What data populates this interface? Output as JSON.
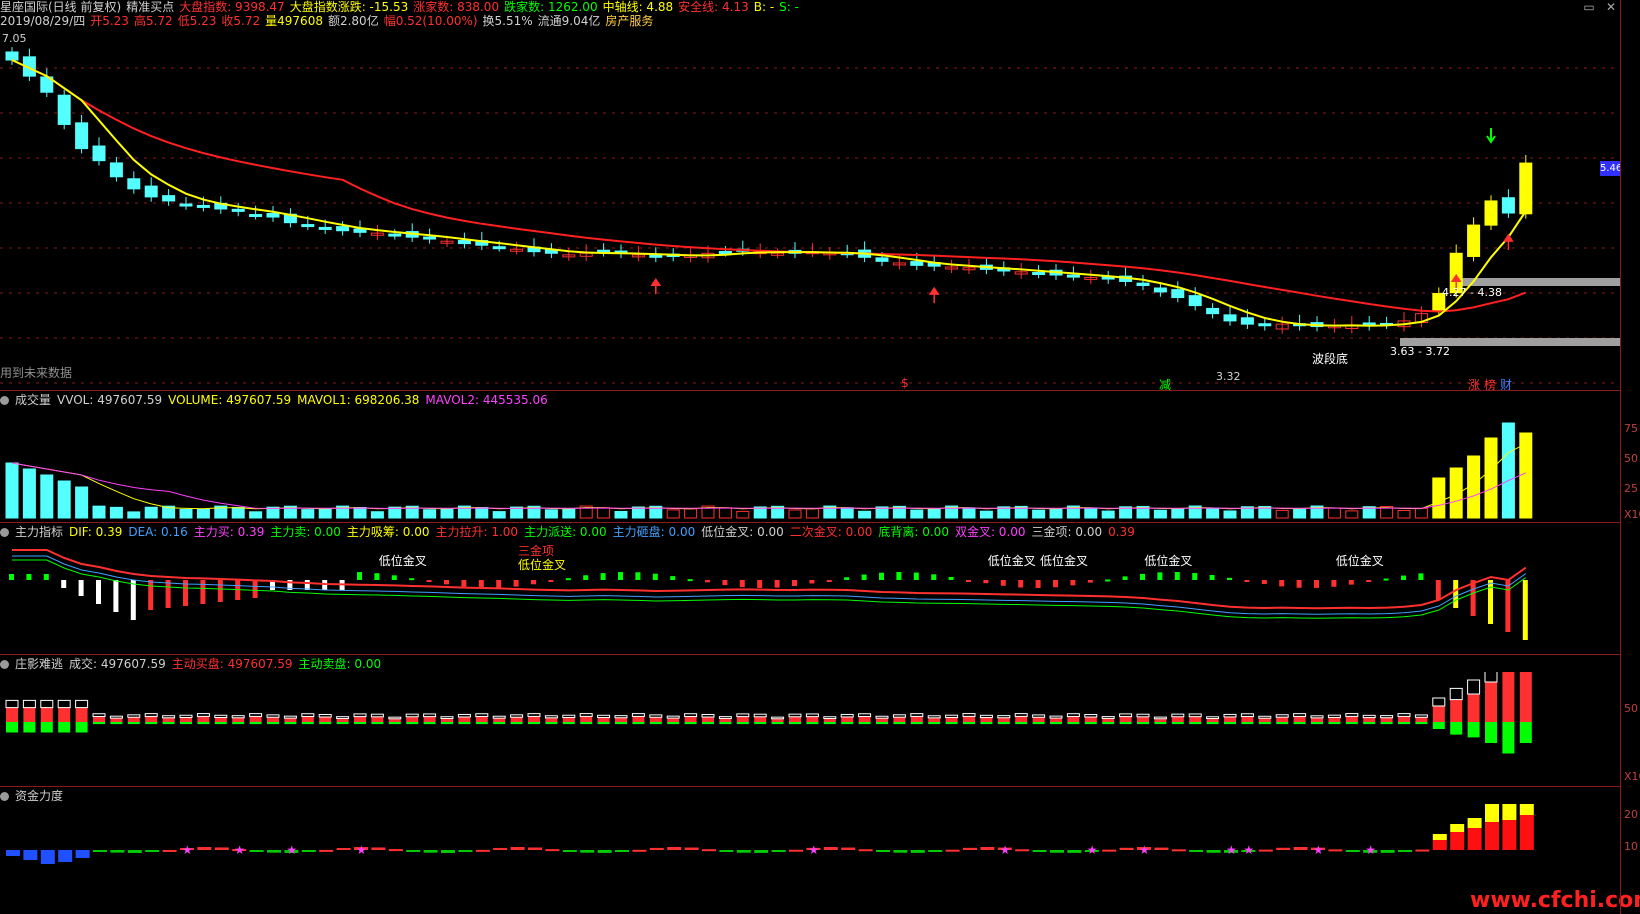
{
  "header": {
    "line1": [
      {
        "text": "星座国际(日线 前复权)",
        "color": "#d0d0d0"
      },
      {
        "text": "精准买点",
        "color": "#d0d0d0"
      },
      {
        "text": "大盘指数: 9398.47",
        "color": "#ff3030"
      },
      {
        "text": "大盘指数涨跌: -15.53",
        "color": "#ffff00"
      },
      {
        "text": "涨家数: 838.00",
        "color": "#ff3030"
      },
      {
        "text": "跌家数: 1262.00",
        "color": "#00ff00"
      },
      {
        "text": "中轴线: 4.88",
        "color": "#ffff00"
      },
      {
        "text": "安全线: 4.13",
        "color": "#ff3030"
      },
      {
        "text": "B: -",
        "color": "#ffff00"
      },
      {
        "text": "S: -",
        "color": "#00ff00"
      }
    ],
    "line2": [
      {
        "text": "2019/08/29/四",
        "color": "#d0d0d0"
      },
      {
        "text": "开5.23",
        "color": "#ff3030"
      },
      {
        "text": "高5.72",
        "color": "#ff3030"
      },
      {
        "text": "低5.23",
        "color": "#ff3030"
      },
      {
        "text": "收5.72",
        "color": "#ff3030"
      },
      {
        "text": "量497608",
        "color": "#ffff00"
      },
      {
        "text": "额2.80亿",
        "color": "#d0d0d0"
      },
      {
        "text": "幅0.52(10.00%)",
        "color": "#ff3030"
      },
      {
        "text": "换5.51%",
        "color": "#d0d0d0"
      },
      {
        "text": "流通9.04亿",
        "color": "#d0d0d0"
      },
      {
        "text": "房产服务",
        "color": "#ffd040"
      }
    ]
  },
  "main_chart": {
    "high_label": "7.05",
    "future_data_label": "用到未来数据",
    "low_label": "3.32",
    "bottom_label": "波段底",
    "zone_upper": "4.27 - 4.38",
    "zone_lower": "3.63 - 3.72",
    "current_price": "5.46",
    "markers": [
      {
        "text": "$",
        "color": "#ff3030"
      },
      {
        "text": "减",
        "color": "#00ff00"
      },
      {
        "text": "涨",
        "color": "#ff3030"
      },
      {
        "text": "榜",
        "color": "#ff3030"
      },
      {
        "text": "财",
        "color": "#4080ff"
      }
    ]
  },
  "volume_pane": {
    "title": [
      {
        "text": "成交量",
        "color": "#d0d0d0"
      },
      {
        "text": "VVOL: 497607.59",
        "color": "#d0d0d0"
      },
      {
        "text": "VOLUME: 497607.59",
        "color": "#ffff00"
      },
      {
        "text": "MAVOL1: 698206.38",
        "color": "#ffff00"
      },
      {
        "text": "MAVOL2: 445535.06",
        "color": "#ff40ff"
      }
    ],
    "ticks": [
      "75",
      "50",
      "25",
      "X10"
    ]
  },
  "main_force_pane": {
    "title": [
      {
        "text": "主力指标",
        "color": "#d0d0d0"
      },
      {
        "text": "DIF: 0.39",
        "color": "#ffff00"
      },
      {
        "text": "DEA: 0.16",
        "color": "#40a0ff"
      },
      {
        "text": "主力买: 0.39",
        "color": "#ff40ff"
      },
      {
        "text": "主力卖: 0.00",
        "color": "#00ff00"
      },
      {
        "text": "主力吸筹: 0.00",
        "color": "#ffff00"
      },
      {
        "text": "主力拉升: 1.00",
        "color": "#ff3030"
      },
      {
        "text": "主力派送: 0.00",
        "color": "#00ff00"
      },
      {
        "text": "主力砸盘: 0.00",
        "color": "#40a0ff"
      },
      {
        "text": "低位金叉: 0.00",
        "color": "#d0d0d0"
      },
      {
        "text": "二次金叉: 0.00",
        "color": "#ff3030"
      },
      {
        "text": "底背离: 0.00",
        "color": "#00ff00"
      },
      {
        "text": "双金叉: 0.00",
        "color": "#ff40ff"
      },
      {
        "text": "三金项: 0.00",
        "color": "#d0d0d0"
      },
      {
        "text": "0.39",
        "color": "#ff3030"
      }
    ],
    "labels": [
      {
        "text": "低位金叉",
        "color": "#ffffff"
      },
      {
        "text": "三金项",
        "color": "#ff3030"
      },
      {
        "text": "低位金叉",
        "color": "#ffff00"
      },
      {
        "text": "低位金叉",
        "color": "#ffffff"
      },
      {
        "text": "低位金叉",
        "color": "#ffffff"
      },
      {
        "text": "低位金叉",
        "color": "#ffffff"
      },
      {
        "text": "低位金叉",
        "color": "#ffffff"
      }
    ]
  },
  "dealer_pane": {
    "title": [
      {
        "text": "庄影难逃",
        "color": "#d0d0d0"
      },
      {
        "text": "成交: 497607.59",
        "color": "#d0d0d0"
      },
      {
        "text": "主动买盘: 497607.59",
        "color": "#ff3030"
      },
      {
        "text": "主动卖盘: 0.00",
        "color": "#00ff00"
      }
    ],
    "ticks": [
      "50",
      "X10"
    ]
  },
  "fund_pane": {
    "title": [
      {
        "text": "资金力度",
        "color": "#d0d0d0"
      }
    ],
    "ticks": [
      "20",
      "10"
    ]
  },
  "watermark": "www.cfchi.com",
  "colors": {
    "up": "#ff3030",
    "down": "#54ffff",
    "ma5": "#ffff00",
    "ma20": "#ff2020",
    "grid": "#8b1a1a"
  }
}
